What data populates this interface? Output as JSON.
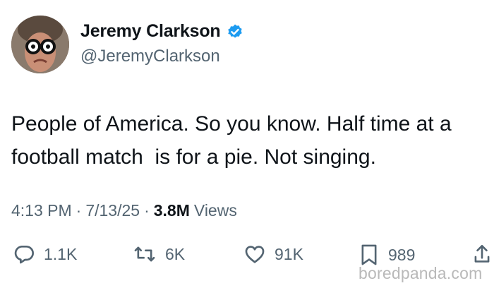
{
  "author": {
    "name": "Jeremy Clarkson",
    "handle": "@JeremyClarkson",
    "verified": true
  },
  "tweet": {
    "text": "People of America. So you know. Half time at a football match  is for a pie. Not singing.",
    "time": "4:13 PM",
    "date": "7/13/25",
    "separator": "·",
    "views_count": "3.8M",
    "views_label": "Views"
  },
  "actions": {
    "replies": "1.1K",
    "reposts": "6K",
    "likes": "91K",
    "bookmarks": "989"
  },
  "watermark": "boredpanda.com",
  "colors": {
    "verified": "#1d9bf0",
    "text": "#0f1419",
    "secondary": "#536471"
  },
  "icons": [
    "reply-icon",
    "retweet-icon",
    "heart-icon",
    "bookmark-icon",
    "share-icon",
    "verified-badge-icon"
  ]
}
